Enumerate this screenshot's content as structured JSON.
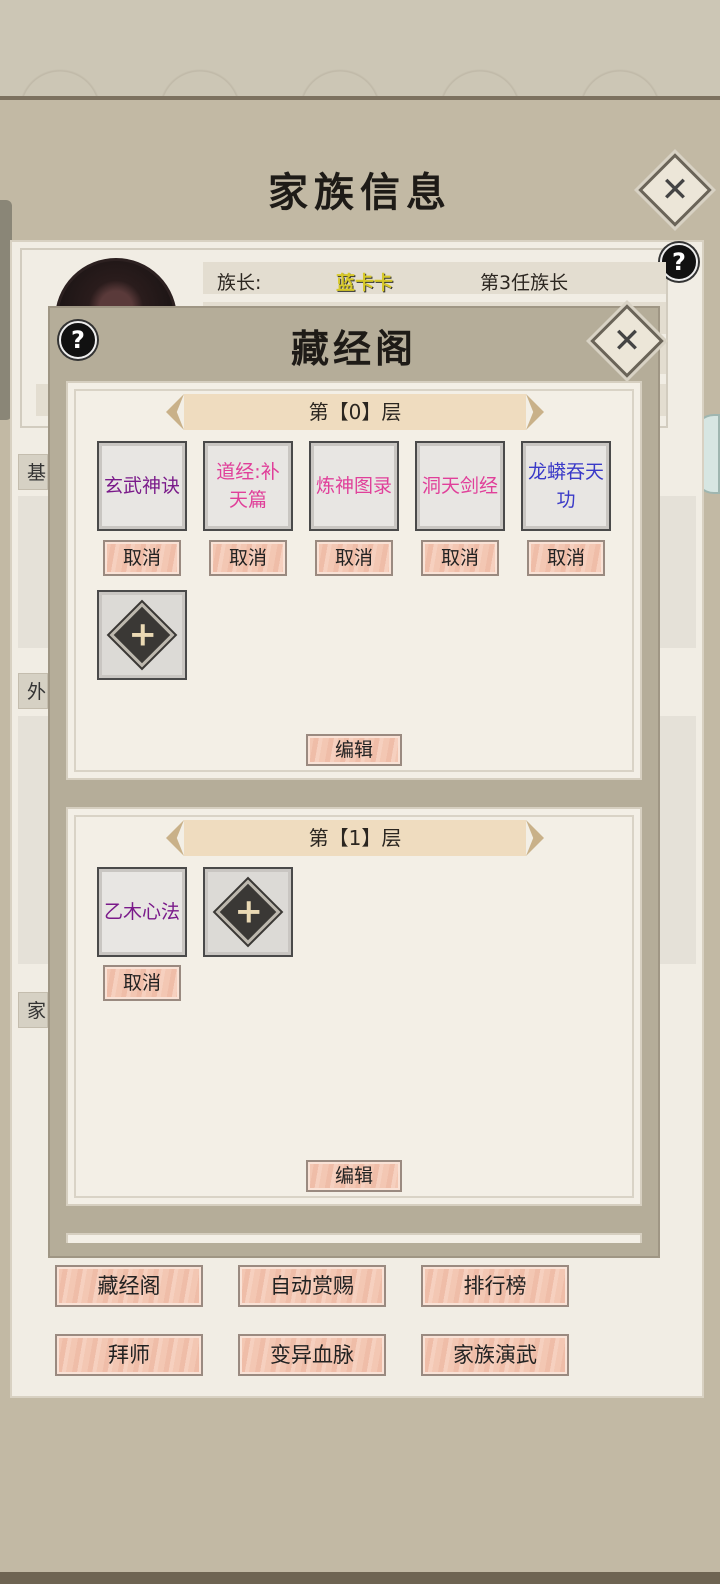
{
  "main": {
    "title": "家族信息",
    "leader_label": "族长:",
    "leader_name": "蓝卡卡",
    "leader_order": "第3任族长",
    "side_tabs": [
      "基",
      "外",
      "家"
    ],
    "buttons": [
      "藏经阁",
      "自动赏赐",
      "排行榜",
      "拜师",
      "变异血脉",
      "家族演武"
    ]
  },
  "pavilion": {
    "title": "藏经阁",
    "floors": [
      {
        "banner": "第【0】层",
        "slots": [
          {
            "name": "玄武神诀",
            "color": "#7a1a8a"
          },
          {
            "name": "道经:补天篇",
            "color": "#e0409a"
          },
          {
            "name": "炼神图录",
            "color": "#e0409a"
          },
          {
            "name": "洞天剑经",
            "color": "#e0409a"
          },
          {
            "name": "龙蟒吞天功",
            "color": "#3a3ac8"
          }
        ],
        "cancel_label": "取消",
        "edit_label": "编辑"
      },
      {
        "banner": "第【1】层",
        "slots": [
          {
            "name": "乙木心法",
            "color": "#7a1a8a"
          }
        ],
        "cancel_label": "取消",
        "edit_label": "编辑"
      }
    ]
  }
}
